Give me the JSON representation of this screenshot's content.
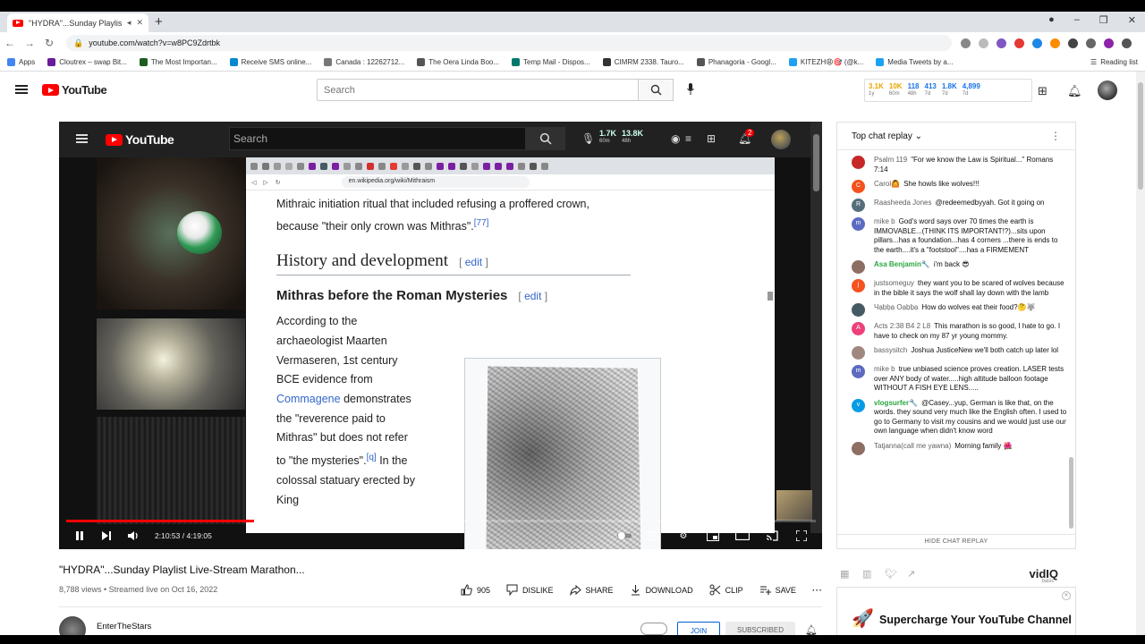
{
  "browser": {
    "tab_title": "\"HYDRA\"...Sunday Playlist Li...",
    "url": "youtube.com/watch?v=w8PC9Zdrtbk",
    "bookmarks": [
      {
        "label": "Apps",
        "color": "#4285f4"
      },
      {
        "label": "Cloutrex – swap Bit...",
        "color": "#6a1b9a"
      },
      {
        "label": "The Most Importan...",
        "color": "#1b5e20"
      },
      {
        "label": "Receive SMS online...",
        "color": "#0288d1"
      },
      {
        "label": "Canada : 12262712...",
        "color": "#777777"
      },
      {
        "label": "The Oera Linda Boo...",
        "color": "#555555"
      },
      {
        "label": "Temp Mail - Dispos...",
        "color": "#00796b"
      },
      {
        "label": "CIMRM 2338. Tauro...",
        "color": "#333333"
      },
      {
        "label": "Phanagoria - Googl...",
        "color": "#555555"
      },
      {
        "label": "KITEZH😩🎯 (@k...",
        "color": "#1da1f2"
      },
      {
        "label": "Media Tweets by a...",
        "color": "#1da1f2"
      }
    ],
    "reading_list": "Reading list"
  },
  "masthead": {
    "logo": "YouTube",
    "search_placeholder": "Search",
    "stats": [
      {
        "value": "3.1K",
        "period": "1y",
        "color": "#e6a700"
      },
      {
        "value": "10K",
        "period": "60m",
        "color": "#e6a700"
      },
      {
        "value": "118",
        "period": "48h",
        "color": "#1a73e8"
      },
      {
        "value": "413",
        "period": "7d",
        "color": "#1a73e8"
      },
      {
        "value": "1.8K",
        "period": "7d",
        "color": "#1a73e8"
      },
      {
        "value": "4,899",
        "period": "7d",
        "color": "#1a73e8"
      }
    ]
  },
  "player": {
    "inner_logo": "YouTube",
    "inner_search": "Search",
    "inner_stats": [
      {
        "value": "1.7K",
        "period": "60m"
      },
      {
        "value": "13.8K",
        "period": "48h"
      }
    ],
    "notif_count": "2",
    "wiki": {
      "url": "en.wikipedia.org/wiki/Mithraism",
      "lead": "Mithraic initiation ritual that included refusing a proffered crown, because \"their only crown was Mithras\".",
      "lead_ref": "[77]",
      "h2": "History and development",
      "h3": "Mithras before the Roman Mysteries",
      "edit_label": "edit",
      "body_1": "According to the archaeologist Maarten Vermaseren, 1st century BCE evidence from",
      "body_link": "Commagene",
      "body_2": "demonstrates the \"reverence paid to Mithras\" but does not refer to \"the mysteries\".",
      "body_ref": "[q]",
      "body_3": "In the colossal statuary erected by King"
    },
    "time": "2:10:53 / 4:19:05",
    "progress": 0.5,
    "progress_color": "#ff0000"
  },
  "video": {
    "title": "\"HYDRA\"...Sunday Playlist Live-Stream Marathon...",
    "meta": "8,788 views • Streamed live on Oct 16, 2022",
    "likes": "905",
    "dislike": "DISLIKE",
    "share": "SHARE",
    "download": "DOWNLOAD",
    "clip": "CLIP",
    "save": "SAVE",
    "channel": "EnterTheStars",
    "join": "JOIN",
    "subscribed": "SUBSCRIBED"
  },
  "chat": {
    "header": "Top chat replay",
    "hide_label": "HIDE CHAT REPLAY",
    "messages": [
      {
        "author": "Psalm 119",
        "text": "\"For we know the Law is Spiritual...\" Romans 7:14",
        "initial": "",
        "color": "#c62828",
        "mod": false
      },
      {
        "author": "Carol🙆",
        "text": "She howls like wolves!!!",
        "initial": "C",
        "color": "#f4511e",
        "mod": false
      },
      {
        "author": "Raasheeda Jones",
        "text": "@redeemedbyyah. Got it going on",
        "initial": "R",
        "color": "#546e7a",
        "mod": false
      },
      {
        "author": "mike b",
        "text": "God's word says over 70 times the earth is IMMOVABLE...(THINK ITS IMPORTANT!?)...sits upon pillars...has a foundation...has 4 corners ...there is ends to the earth....it's a \"footstool\"....has a FIRMEMENT",
        "initial": "m",
        "color": "#5c6bc0",
        "mod": false
      },
      {
        "author": "Asa Benjamin🔧",
        "text": "i'm back 😎",
        "initial": "",
        "color": "#8d6e63",
        "mod": true
      },
      {
        "author": "justsomeguy",
        "text": "they want you to be scared of wolves because in the bible it says the wolf shall lay down with the lamb",
        "initial": "j",
        "color": "#f4511e",
        "mod": false
      },
      {
        "author": "Чạḅḅạ Oạḅḅạ",
        "text": "How do wolves eat their food?🤔🐺",
        "initial": "",
        "color": "#455a64",
        "mod": false
      },
      {
        "author": "Acts 2:38 B4 2 L8",
        "text": "This marathon is so good, I hate to go. I have to check on my 87 yr young mommy.",
        "initial": "A",
        "color": "#ec407a",
        "mod": false
      },
      {
        "author": "bassysitch",
        "text": "Joshua JusticeNew we'll both catch up later lol",
        "initial": "",
        "color": "#a1887f",
        "mod": false
      },
      {
        "author": "mike b",
        "text": "true unbiased science proves creation. LASER tests over ANY body of water.....high altitude balloon footage WITHOUT A FISH EYE LENS.....",
        "initial": "m",
        "color": "#5c6bc0",
        "mod": false
      },
      {
        "author": "vlogsurfer🔧",
        "text": "@Casey...yup, German is like that, on the words. they sound very much like the English often. I used to go to Germany to visit my cousins and we would just use our own language when didn't know word",
        "initial": "v",
        "color": "#039be5",
        "mod": true
      },
      {
        "author": "Tatjanna(call me yawna)",
        "text": "Morning family 🌺",
        "initial": "",
        "color": "#8d6e63",
        "mod": false
      }
    ]
  },
  "vidiq": {
    "logo": "vidIQ",
    "tier": "basic",
    "promo": "Supercharge Your YouTube Channel"
  }
}
